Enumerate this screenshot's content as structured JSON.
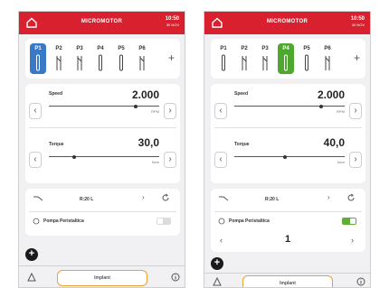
{
  "colors": {
    "header": "#d9202f",
    "active_blue": "#3a78c8",
    "active_green": "#4ea82f",
    "toggle_on": "#5fae3b",
    "implant_border": "#e9a233"
  },
  "icons": {
    "home": "home-icon",
    "handpiece": "handpiece-icon",
    "rotation": "rotate-icon",
    "pump": "pump-icon",
    "warning": "warning-icon",
    "info": "info-icon"
  },
  "screens": [
    {
      "header": {
        "title": "MICROMOTOR",
        "time": "10:50",
        "date": "30 NOV"
      },
      "programs": [
        {
          "label": "P1"
        },
        {
          "label": "P2"
        },
        {
          "label": "P3"
        },
        {
          "label": "P4"
        },
        {
          "label": "P5"
        },
        {
          "label": "P6"
        }
      ],
      "add_label": "+",
      "speed": {
        "label": "Speed",
        "value": "2.000",
        "unit": "RPM"
      },
      "torque": {
        "label": "Torque",
        "value": "30,0",
        "unit": "Ncm"
      },
      "ratio": "R:20 L",
      "pump": {
        "label": "Pompa Peristaltica",
        "enabled": false
      },
      "fab": "+",
      "implant_label": "Implant"
    },
    {
      "header": {
        "title": "MICROMOTOR",
        "time": "10:50",
        "date": "30 NOV"
      },
      "programs": [
        {
          "label": "P1"
        },
        {
          "label": "P2"
        },
        {
          "label": "P3"
        },
        {
          "label": "P4"
        },
        {
          "label": "P5"
        },
        {
          "label": "P6"
        }
      ],
      "add_label": "+",
      "speed": {
        "label": "Speed",
        "value": "2.000",
        "unit": "RPM"
      },
      "torque": {
        "label": "Torque",
        "value": "40,0",
        "unit": "Ncm"
      },
      "ratio": "R:20 L",
      "pump": {
        "label": "Pompa Peristaltica",
        "enabled": true,
        "level": "1"
      },
      "fab": "+",
      "implant_label": "Implant"
    }
  ]
}
